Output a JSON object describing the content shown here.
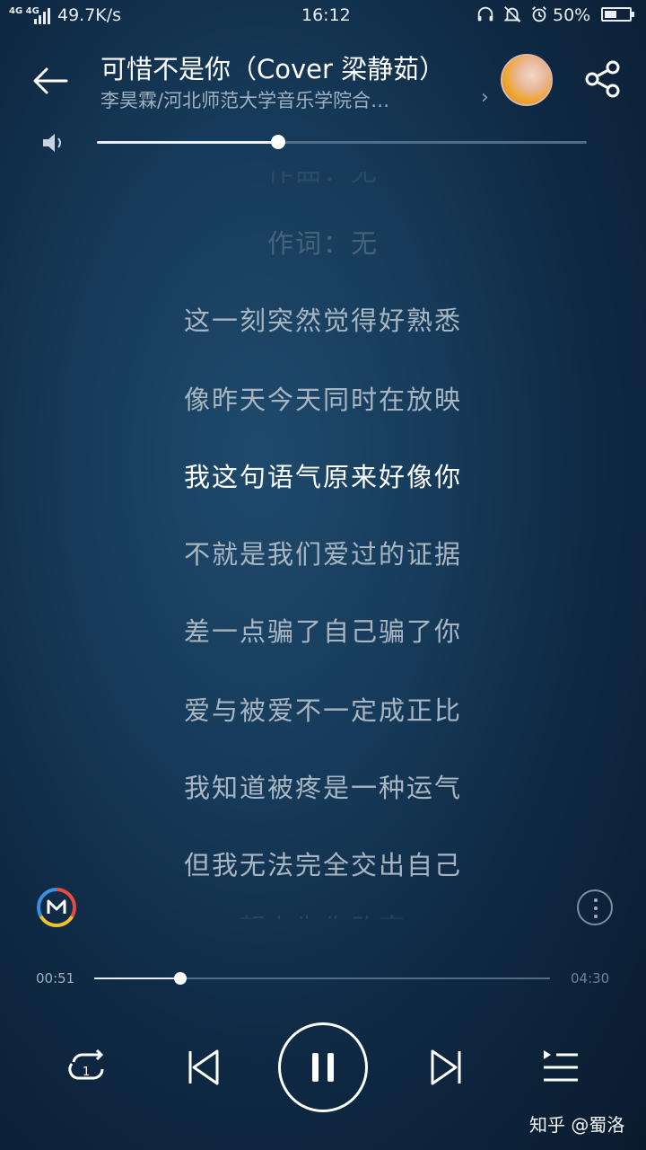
{
  "status_bar": {
    "network": "4G 4G",
    "speed": "49.7K/s",
    "time": "16:12",
    "battery_pct": "50%",
    "battery_level": 0.5
  },
  "header": {
    "title": "可惜不是你（Cover 梁静茹）",
    "artist": "李昊霖/河北师范大学音乐学院合…"
  },
  "volume": {
    "level": 0.37
  },
  "lyrics": [
    {
      "text": "作曲：无",
      "state": "faded2"
    },
    {
      "text": "作词：无",
      "state": "faded"
    },
    {
      "text": "这一刻突然觉得好熟悉",
      "state": "normal"
    },
    {
      "text": "像昨天今天同时在放映",
      "state": "normal"
    },
    {
      "text": "我这句语气原来好像你",
      "state": "active"
    },
    {
      "text": "不就是我们爱过的证据",
      "state": "normal"
    },
    {
      "text": "差一点骗了自己骗了你",
      "state": "normal"
    },
    {
      "text": "爱与被爱不一定成正比",
      "state": "normal"
    },
    {
      "text": "我知道被疼是一种运气",
      "state": "normal"
    },
    {
      "text": "但我无法完全交出自己",
      "state": "normal"
    },
    {
      "text": "努力为你改变",
      "state": "faded2"
    }
  ],
  "playback": {
    "current_time": "00:51",
    "total_time": "04:30",
    "progress": 0.189
  },
  "controls": {
    "repeat_badge": "1"
  },
  "watermark": "知乎 @蜀洛"
}
